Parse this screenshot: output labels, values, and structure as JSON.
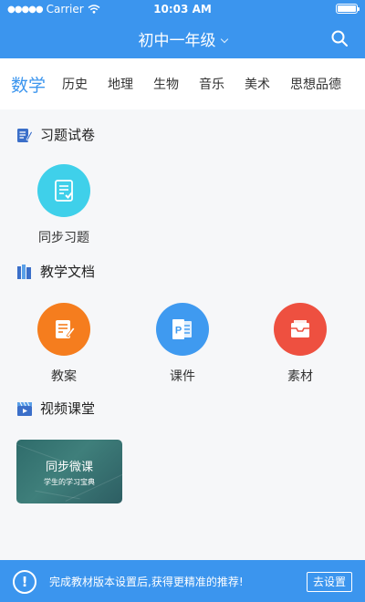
{
  "status": {
    "carrier": "Carrier",
    "time": "10:03 AM"
  },
  "nav": {
    "title": "初中一年级"
  },
  "tabs": [
    "数学",
    "历史",
    "地理",
    "生物",
    "音乐",
    "美术",
    "思想品德"
  ],
  "sections": {
    "exercises": {
      "title": "习题试卷",
      "items": [
        "同步习题"
      ]
    },
    "docs": {
      "title": "教学文档",
      "items": [
        "教案",
        "课件",
        "素材"
      ]
    },
    "video": {
      "title": "视频课堂",
      "card": {
        "title": "同步微课",
        "subtitle": "学生的学习宝典"
      }
    }
  },
  "bottom": {
    "message": "完成教材版本设置后,获得更精准的推荐!",
    "button": "去设置"
  },
  "colors": {
    "primary": "#3b95ee",
    "cyan": "#3fd0ea",
    "orange": "#f57d1e",
    "blue": "#3f9af0",
    "red": "#ee5040"
  },
  "icons": [
    "wifi-icon",
    "battery-icon",
    "search-icon",
    "chevron-down-icon",
    "edit-doc-icon",
    "books-icon",
    "clapper-icon",
    "checklist-icon",
    "lesson-plan-icon",
    "powerpoint-icon",
    "archive-box-icon",
    "alert-icon"
  ]
}
